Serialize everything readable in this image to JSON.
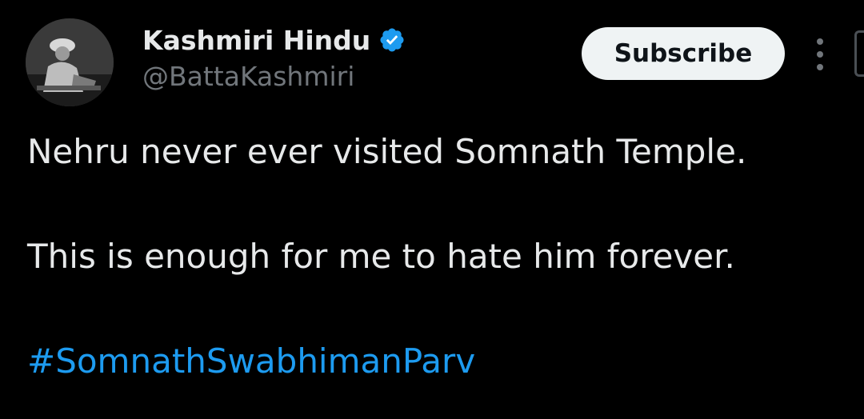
{
  "author": {
    "display_name": "Kashmiri Hindu",
    "handle": "@BattaKashmiri",
    "verified_icon": "verified-badge-icon",
    "verified_color": "#1d9bf0"
  },
  "actions": {
    "subscribe_label": "Subscribe",
    "more_icon": "more-vertical-icon"
  },
  "tweet": {
    "line1": "Nehru never ever visited Somnath Temple.",
    "line2": "This is enough for me to hate him forever.",
    "hashtag": "#SomnathSwabhimanParv"
  },
  "colors": {
    "background": "#000000",
    "text": "#e7e9ea",
    "muted": "#71767b",
    "link": "#1d9bf0",
    "button_bg": "#eff3f4"
  }
}
